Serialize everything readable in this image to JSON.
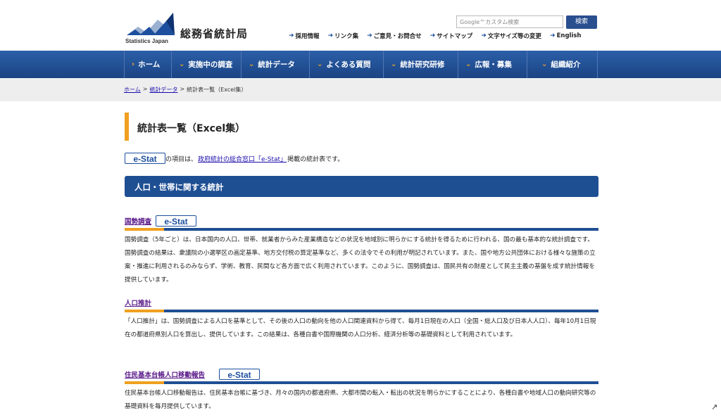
{
  "header": {
    "logo_jp": "総務省統計局",
    "logo_en": "Statistics Japan",
    "search_placeholder": "Google™カスタム検索",
    "search_button": "検索",
    "util_links": [
      "採用情報",
      "リンク集",
      "ご意見・お問合せ",
      "サイトマップ",
      "文字サイズ等の変更",
      "English"
    ]
  },
  "nav": {
    "items": [
      "ホーム",
      "実施中の調査",
      "統計データ",
      "よくある質問",
      "統計研究研修",
      "広報・募集",
      "組織紹介"
    ]
  },
  "breadcrumb": {
    "home": "ホーム",
    "sep": ">",
    "data": "統計データ",
    "current": "統計表一覧（Excel集）"
  },
  "main": {
    "title": "統計表一覧（Excel集）",
    "estat_label": "e-Stat",
    "note_prefix": "の項目は、",
    "note_link": "政府統計の総合窓口「e-Stat」",
    "note_suffix": "掲載の統計表です。",
    "section_title": "人口・世帯に関する統計",
    "subsections": [
      {
        "title": "国勢調査",
        "text": "国勢調査（5年ごと）は、日本国内の人口、世帯、就業者からみた産業構造などの状況を地域別に明らかにする統計を得るために行われる、国の最も基本的な統計調査です。国勢調査の結果は、衆議院の小選挙区の画定基準、地方交付税の算定基準など、多くの法令でその利用が明記されています。また、国や地方公共団体における様々な施策の立案・推進に利用されるのみならず、学術、教育、民間など各方面で広く利用されています。このように、国勢調査は、国民共有の財産として民主主義の基盤を成す統計情報を提供しています。"
      },
      {
        "title": "人口推計",
        "text": "「人口推計」は、国勢調査による人口を基準として、その後の人口の動向を他の人口関連資料から得て、毎月1日現在の人口（全国・総人口及び日本人人口）、毎年10月1日現在の都道府県別人口を算出し、提供しています。この結果は、各種白書や国際機関の人口分析、経済分析等の基礎資料として利用されています。"
      },
      {
        "title": "住民基本台帳人口移動報告",
        "text": "住民基本台帳人口移動報告は、住民基本台帳に基づき、月々の国内の都道府県、大都市間の転入・転出の状況を明らかにすることにより、各種白書や地域人口の動向研究等の基礎資料を毎月提供しています。"
      }
    ]
  }
}
